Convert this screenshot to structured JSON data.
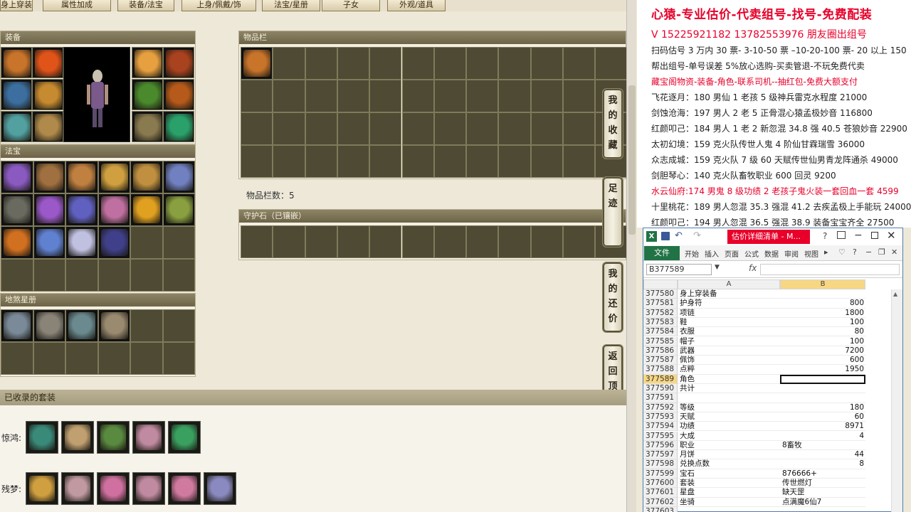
{
  "top_tabs": [
    "身上穿装备",
    "属性加成",
    "装备/法宝",
    "上身/佩戴/饰",
    "法宝/星册",
    "子女",
    "外观/道具"
  ],
  "equip_panel": {
    "title": "装备",
    "colors": [
      "#c8742a",
      "#e0541a",
      "#e7a040",
      "#a9421e",
      "#3c6fa0",
      "#c68a30",
      "#4a8a2c",
      "#b55a1a",
      "#52a0a0",
      "#b08a4a",
      "#8a7a50",
      "#2aa06a"
    ]
  },
  "fabao_panel": {
    "title": "法宝",
    "colors": [
      "#8a5ac0",
      "#a07040",
      "#c08040",
      "#d0a040",
      "#c09040",
      "#7080c0",
      "#6a6a60",
      "#9a58c8",
      "#6060c0",
      "#c070a0",
      "#e0a020",
      "#8aa040",
      "#d07020",
      "#6080d0",
      "#c0c0e0",
      "#40408a"
    ]
  },
  "star_panel": {
    "title": "地煞星册",
    "colors": [
      "#7a8a98",
      "#8a8478",
      "#6a8a90",
      "#9a8a70"
    ]
  },
  "bag_panel": {
    "title": "物品栏",
    "count_label": "物品栏数：5",
    "item_color": "#c8742a"
  },
  "guard_panel": {
    "title": "守护石（已镶嵌）"
  },
  "side_buttons": [
    "我的收藏",
    "足迹",
    "我的还价",
    "返回顶部"
  ],
  "suits": {
    "title": "已收录的套装",
    "rows": [
      {
        "label": "惊鸿:",
        "colors": [
          "#3a8a7a",
          "#c0a070",
          "#5a8a40",
          "#c08aa0",
          "#3aa060"
        ]
      },
      {
        "label": "残梦:",
        "colors": [
          "#d0a040",
          "#c09aa0",
          "#d070a0",
          "#c08aa0",
          "#d07aa0",
          "#8a8ac0"
        ]
      }
    ]
  },
  "ad_text": {
    "headline": "心猿-专业估价-代卖组号-找号-免费配装",
    "contact": "V 15225921182   13782553976 朋友圈出组号",
    "lines": [
      {
        "text": "扫码估号 3 万内 30 票- 3-10-50 票  –10-20-100 票- 20 以上 150",
        "red": false
      },
      {
        "text": "帮出组号-单号误差 5%放心选购-买卖管退-不玩免费代卖",
        "red": false
      },
      {
        "text": "藏宝阁物资-装备-角色-联系司机--抽红包-免费大额支付",
        "red": true
      },
      {
        "text": "飞花逐月：180 男仙 1 老孩 5 级神兵雷克水程度 21000",
        "red": false
      },
      {
        "text": "剑蚀沧海：197 男人 2 老 5 正骨混心猿孟极妙音 116800",
        "red": false
      },
      {
        "text": "红颜叩己：184 男人 1 老 2 新忽混 34.8 强 40.5 苍狼妙音 22900",
        "red": false
      },
      {
        "text": "太初幻境：159 克火队传世人鬼 4 阶仙甘霖瑞雪 36000",
        "red": false
      },
      {
        "text": "众志成城：159 克火队 7 级 60 天赋传世仙男青龙阵通杀 49000",
        "red": false
      },
      {
        "text": "剑胆琴心：140 克火队畜牧职业 600 回灵 9200",
        "red": false
      },
      {
        "text": "水云仙府:174 男鬼 8 级功绩 2 老孩子鬼火装一套回血一套 4599",
        "red": true
      },
      {
        "text": "十里桃花：189 男人忽混 35.3 强混 41.2 去疾孟极上手能玩 24000",
        "red": false
      },
      {
        "text": "红颜叩己：194 男人忽混 36.5 强混 38.9 装备宝宝齐全 27500",
        "red": false
      }
    ]
  },
  "excel": {
    "title": "估价详细清单 - M...",
    "file_tab": "文件",
    "ribbon_tabs": [
      "开始",
      "插入",
      "页面",
      "公式",
      "数据",
      "审阅",
      "视图"
    ],
    "name_box": "B377589",
    "fx": "fx",
    "col_a": "A",
    "col_b": "B",
    "selected_row": "377589",
    "rows": [
      {
        "n": "377580",
        "a": "身上穿装备",
        "b": "",
        "num": true
      },
      {
        "n": "377581",
        "a": "护身符",
        "b": "800",
        "num": true
      },
      {
        "n": "377582",
        "a": "项链",
        "b": "1800",
        "num": true
      },
      {
        "n": "377583",
        "a": "鞋",
        "b": "100",
        "num": true
      },
      {
        "n": "377584",
        "a": "衣服",
        "b": "80",
        "num": true
      },
      {
        "n": "377585",
        "a": "帽子",
        "b": "100",
        "num": true
      },
      {
        "n": "377586",
        "a": "武器",
        "b": "7200",
        "num": true
      },
      {
        "n": "377587",
        "a": "佩饰",
        "b": "600",
        "num": true
      },
      {
        "n": "377588",
        "a": "点粹",
        "b": "1950",
        "num": true
      },
      {
        "n": "377589",
        "a": "角色",
        "b": "",
        "num": true
      },
      {
        "n": "377590",
        "a": "共计",
        "b": "",
        "num": true
      },
      {
        "n": "377591",
        "a": "",
        "b": "",
        "num": true
      },
      {
        "n": "377592",
        "a": "等级",
        "b": "180",
        "num": true
      },
      {
        "n": "377593",
        "a": "天赋",
        "b": "60",
        "num": true
      },
      {
        "n": "377594",
        "a": "功绩",
        "b": "8971",
        "num": true
      },
      {
        "n": "377595",
        "a": "大成",
        "b": "4",
        "num": true
      },
      {
        "n": "377596",
        "a": "职业",
        "b": "8畜牧",
        "num": false
      },
      {
        "n": "377597",
        "a": "月饼",
        "b": "44",
        "num": true
      },
      {
        "n": "377598",
        "a": "兑换点数",
        "b": "8",
        "num": true
      },
      {
        "n": "377599",
        "a": "宝石",
        "b": "876666+",
        "num": false
      },
      {
        "n": "377600",
        "a": "套装",
        "b": "传世燃灯",
        "num": false
      },
      {
        "n": "377601",
        "a": "星盘",
        "b": "缺天罡",
        "num": false
      },
      {
        "n": "377602",
        "a": "坐骑",
        "b": "点满魔6仙7",
        "num": false
      },
      {
        "n": "377603",
        "a": "",
        "b": "",
        "num": false
      }
    ]
  }
}
